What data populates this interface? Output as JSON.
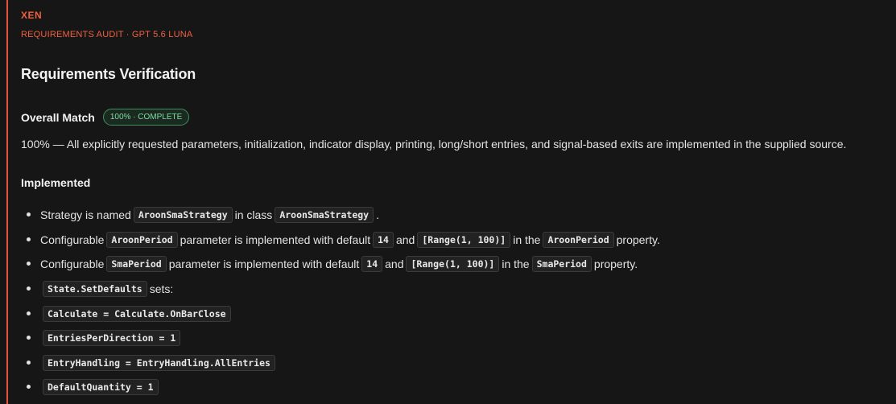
{
  "brand": "XEN",
  "subtitle": "REQUIREMENTS AUDIT · GPT 5.6 LUNA",
  "page_title": "Requirements Verification",
  "overall": {
    "label": "Overall Match",
    "badge": "100% · COMPLETE",
    "summary": "100% — All explicitly requested parameters, initialization, indicator display, printing, long/short entries, and signal-based exits are implemented in the supplied source."
  },
  "implemented": {
    "heading": "Implemented",
    "items": [
      {
        "t1": "Strategy is named",
        "c1": "AroonSmaStrategy",
        "t2": "in class",
        "c2": "AroonSmaStrategy",
        "t3": "."
      },
      {
        "t1": "Configurable",
        "c1": "AroonPeriod",
        "t2": "parameter is implemented with default",
        "c2": "14",
        "t3": "and",
        "c3": "[Range(1, 100)]",
        "t4": "in the",
        "c4": "AroonPeriod",
        "t5": "property."
      },
      {
        "t1": "Configurable",
        "c1": "SmaPeriod",
        "t2": "parameter is implemented with default",
        "c2": "14",
        "t3": "and",
        "c3": "[Range(1, 100)]",
        "t4": "in the",
        "c4": "SmaPeriod",
        "t5": "property."
      },
      {
        "c1": "State.SetDefaults",
        "t2": "sets:"
      },
      {
        "c1": "Calculate = Calculate.OnBarClose"
      },
      {
        "c1": "EntriesPerDirection = 1"
      },
      {
        "c1": "EntryHandling = EntryHandling.AllEntries"
      },
      {
        "c1": "DefaultQuantity = 1"
      }
    ]
  },
  "colors": {
    "accent": "#f0603f",
    "badge_text": "#7fd9a0",
    "background": "#161616"
  }
}
